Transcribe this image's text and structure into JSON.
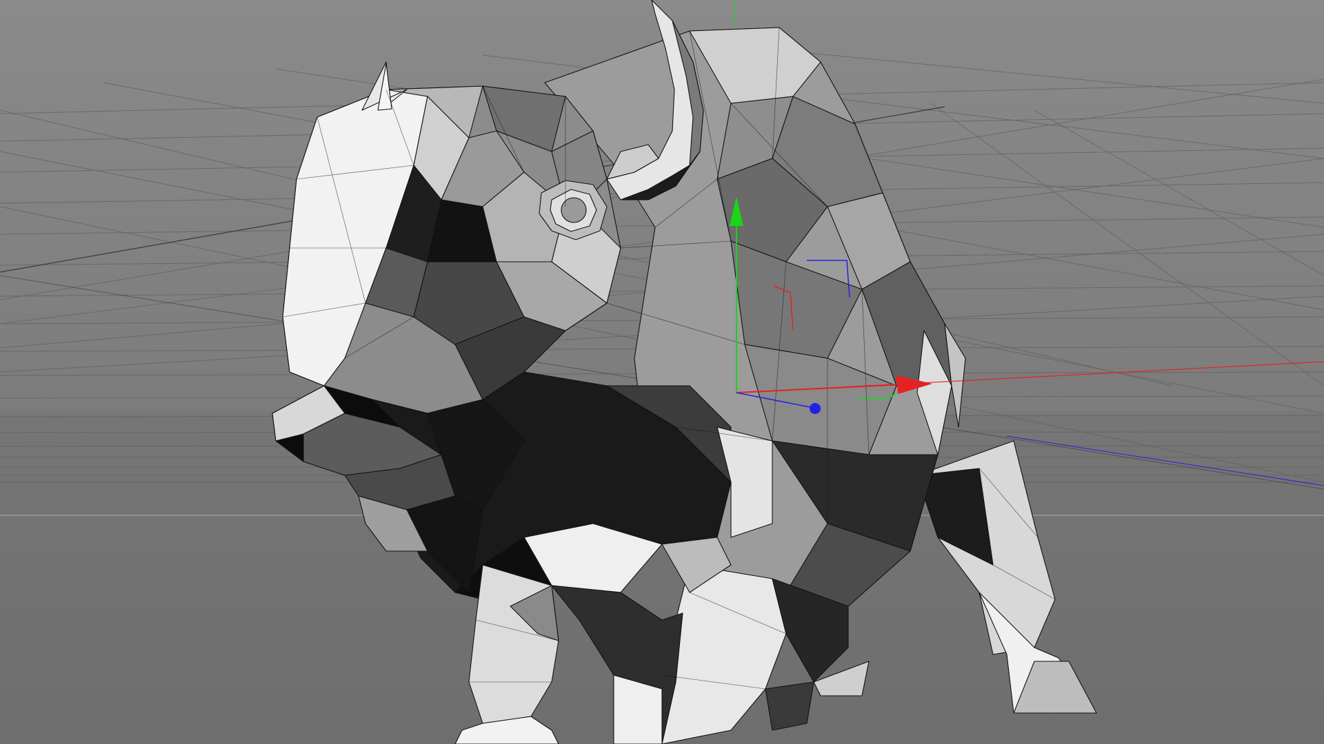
{
  "viewport": {
    "mode": "perspective",
    "display": "shaded-wireframe",
    "background_color": "#7a7a7a",
    "grid_color": "#5e5e5e",
    "wire_color": "#111111"
  },
  "model": {
    "object": "bison",
    "style": "low-poly"
  },
  "gizmo": {
    "type": "move",
    "x_color": "#e52222",
    "y_color": "#19d619",
    "z_color": "#2222e5"
  }
}
